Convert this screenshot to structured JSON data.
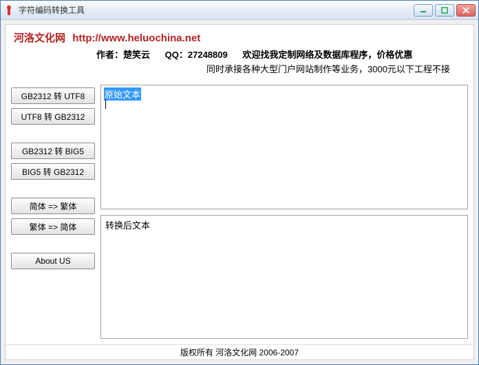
{
  "window": {
    "title": "字符编码转换工具"
  },
  "header": {
    "siteName": "河洛文化网",
    "siteUrl": "http://www.heluochina.net",
    "authorLabel": "作者：",
    "authorName": "楚笑云",
    "qqLabel": "QQ：",
    "qqNumber": "27248809",
    "tagline": "欢迎找我定制网络及数据库程序，价格优惠",
    "subline": "同时承接各种大型门户网站制作等业务，3000元以下工程不接"
  },
  "buttons": {
    "gb2utf": "GB2312 转 UTF8",
    "utf2gb": "UTF8 转 GB2312",
    "gb2big5": "GB2312 转 BIG5",
    "big52gb": "BIG5 转 GB2312",
    "simp2trad": "简体 => 繁体",
    "trad2simp": "繁体 => 简体",
    "about": "About US"
  },
  "panes": {
    "sourceSelected": "原始文本",
    "sourceValue": "原始文本\n",
    "resultValue": "转换后文本"
  },
  "footer": {
    "copyright": "版权所有 河洛文化网 2006-2007"
  }
}
